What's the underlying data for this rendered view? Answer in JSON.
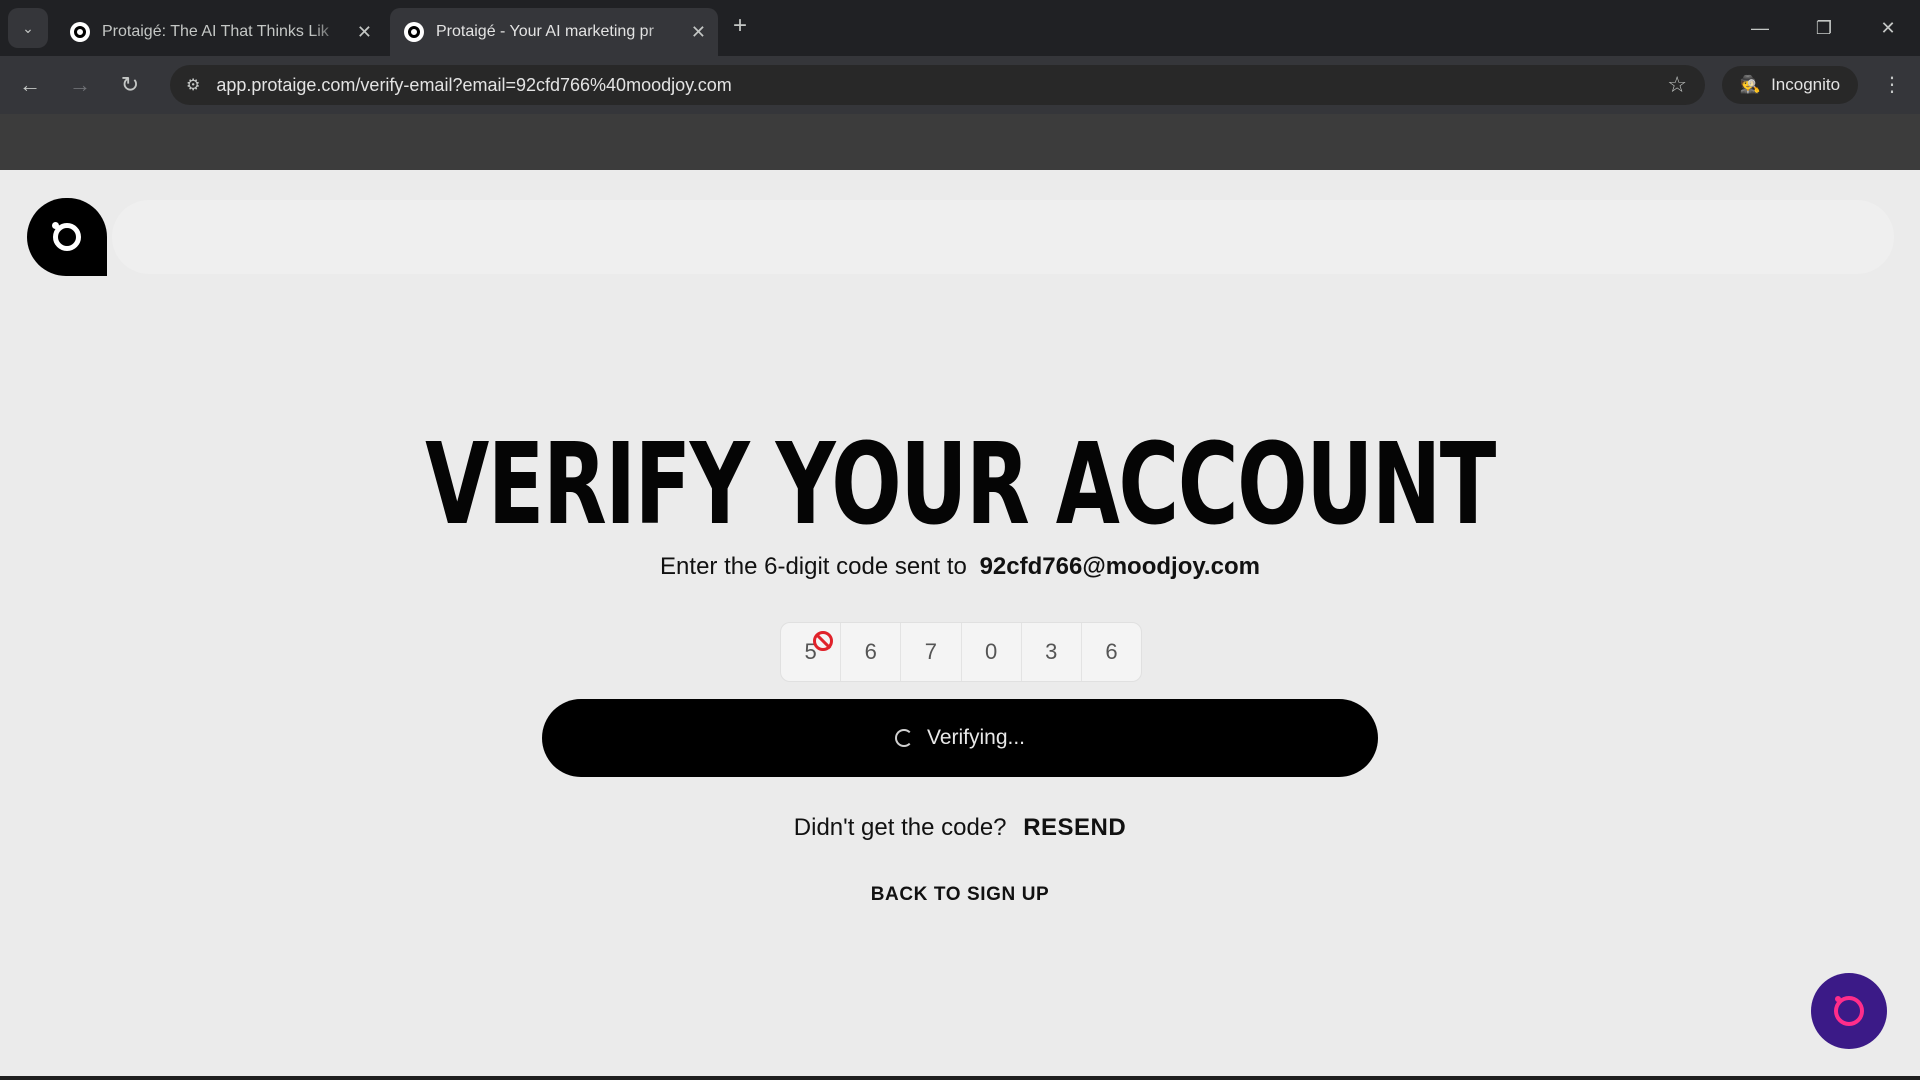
{
  "browser": {
    "tabs": [
      {
        "title": "Protaigé: The AI That Thinks Lik",
        "active": false
      },
      {
        "title": "Protaigé - Your AI marketing pr",
        "active": true
      }
    ],
    "url": "app.protaige.com/verify-email?email=92cfd766%40moodjoy.com",
    "incognito_label": "Incognito",
    "icons": {
      "tab_search": "chevron-down-icon",
      "close": "close-icon",
      "new_tab": "plus-icon",
      "back": "back-arrow-icon",
      "forward": "forward-arrow-icon",
      "reload": "reload-icon",
      "site_info": "tune-icon",
      "bookmark": "star-icon",
      "incognito": "incognito-icon",
      "menu": "kebab-menu-icon"
    }
  },
  "page": {
    "heading": "VERIFY YOUR ACCOUNT",
    "subtitle_prefix": "Enter the 6-digit code sent to",
    "email": "92cfd766@moodjoy.com",
    "code_digits": [
      "5",
      "6",
      "7",
      "0",
      "3",
      "6"
    ],
    "verify_button_label": "Verifying...",
    "resend_prompt": "Didn't get the code?",
    "resend_label": "RESEND",
    "back_link_label": "BACK TO SIGN UP"
  },
  "colors": {
    "page_bg": "#ebebeb",
    "button_bg": "#000000",
    "chat_fab_bg": "#3b1a87",
    "chat_fab_accent": "#ff2d8a",
    "blocked_cursor": "#e0222a"
  }
}
